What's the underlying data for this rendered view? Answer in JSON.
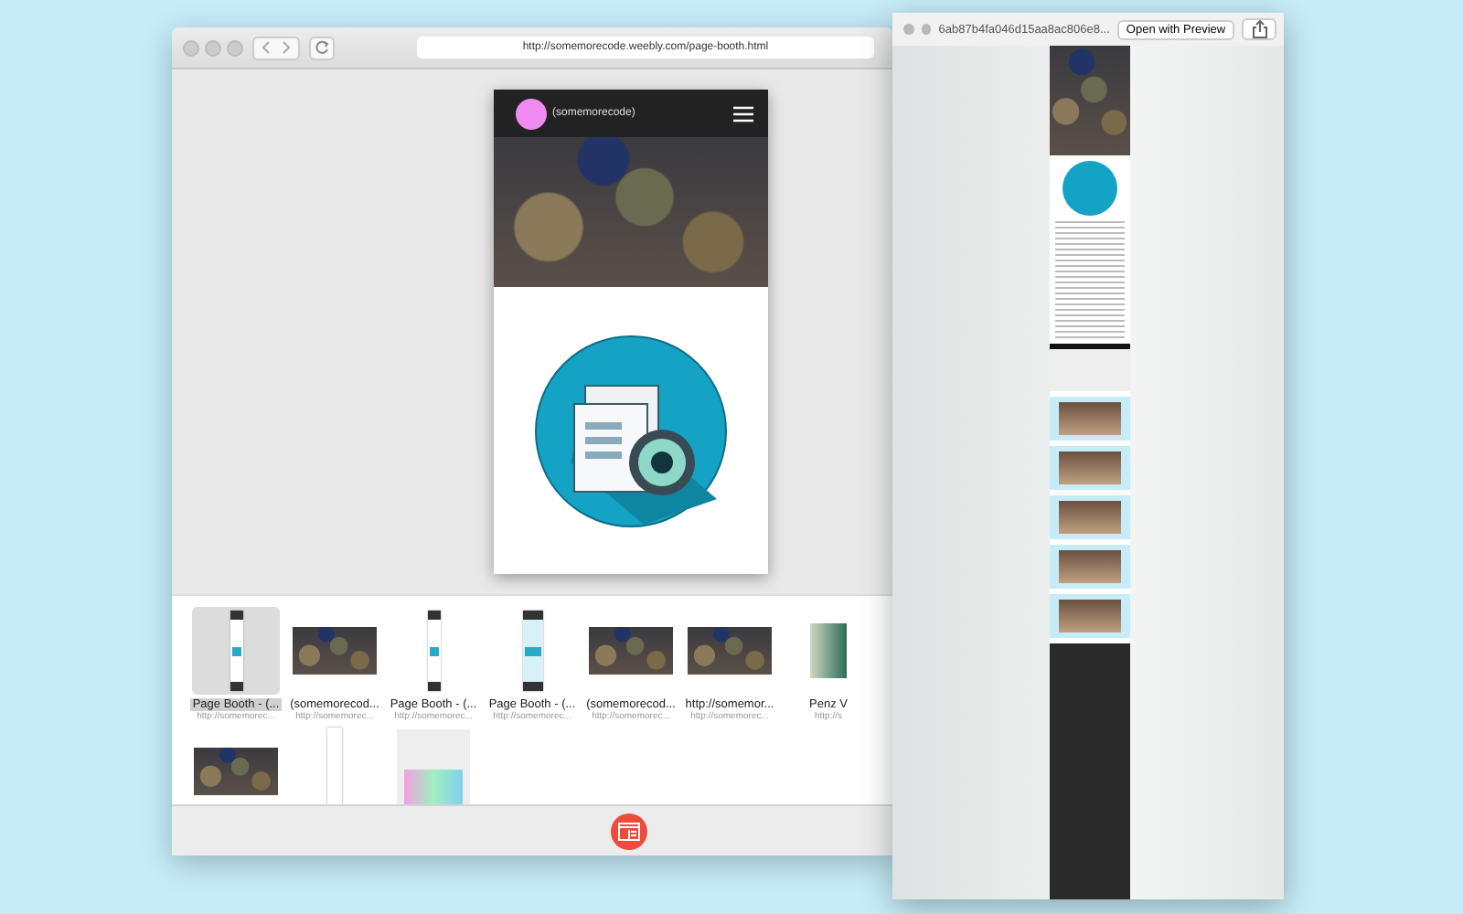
{
  "browser": {
    "url": "http://somemorecode.weebly.com/page-booth.html",
    "site_title": "(somemorecode)"
  },
  "thumbnails": [
    {
      "kind": "tall",
      "title": "Page Booth - (...",
      "subtitle": "http://somemorec...",
      "selected": true
    },
    {
      "kind": "bokeh",
      "title": "(somemorecod...",
      "subtitle": "http://somemorec...",
      "selected": false
    },
    {
      "kind": "tall",
      "title": "Page Booth - (...",
      "subtitle": "http://somemorec...",
      "selected": false
    },
    {
      "kind": "tall-blue",
      "title": "Page Booth - (...",
      "subtitle": "http://somemorec...",
      "selected": false
    },
    {
      "kind": "bokeh",
      "title": "(somemorecod...",
      "subtitle": "http://somemorec...",
      "selected": false
    },
    {
      "kind": "bokeh",
      "title": "http://somemor...",
      "subtitle": "http://somemorec...",
      "selected": false
    },
    {
      "kind": "green",
      "title": "Penz V",
      "subtitle": "http://s",
      "selected": false
    },
    {
      "kind": "bokeh",
      "selected": false
    },
    {
      "kind": "narrow",
      "selected": false
    },
    {
      "kind": "card",
      "selected": false
    }
  ],
  "preview": {
    "title": "6ab87b4fa046d15aa8ac806e8...",
    "open_button": "Open with Preview"
  }
}
